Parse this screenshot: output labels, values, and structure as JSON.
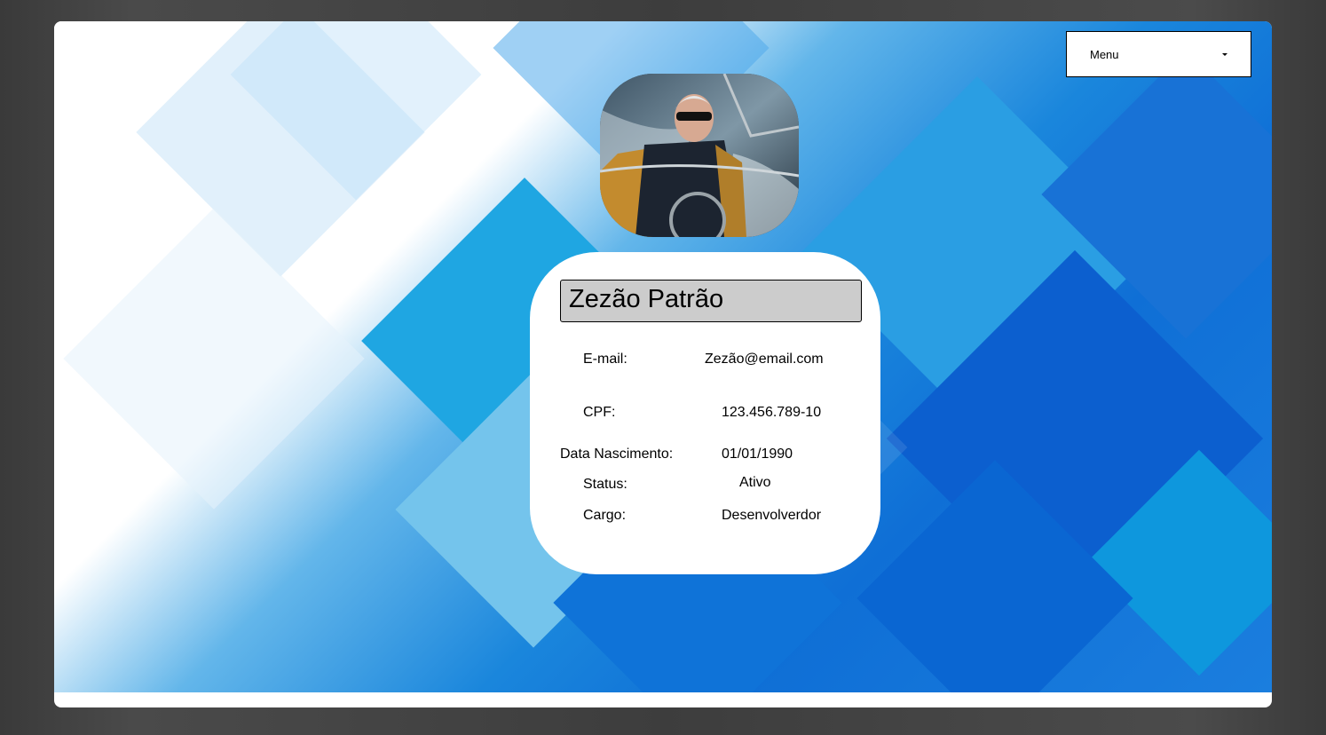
{
  "menu": {
    "label": "Menu"
  },
  "profile": {
    "name": "Zezão Patrão",
    "fields": [
      {
        "label": "E-mail:",
        "value": "Zezão@email.com"
      },
      {
        "label": "CPF:",
        "value": "123.456.789-10"
      },
      {
        "label": "Data Nascimento:",
        "value": "01/01/1990"
      },
      {
        "label": "Status:",
        "value": "Ativo"
      },
      {
        "label": "Cargo:",
        "value": "Desenvolverdor"
      }
    ]
  },
  "icons": {
    "menu_caret": "chevron-down-icon"
  },
  "colors": {
    "background_blue": "#1a86dc",
    "name_box": "#cccccc",
    "card": "#ffffff"
  }
}
